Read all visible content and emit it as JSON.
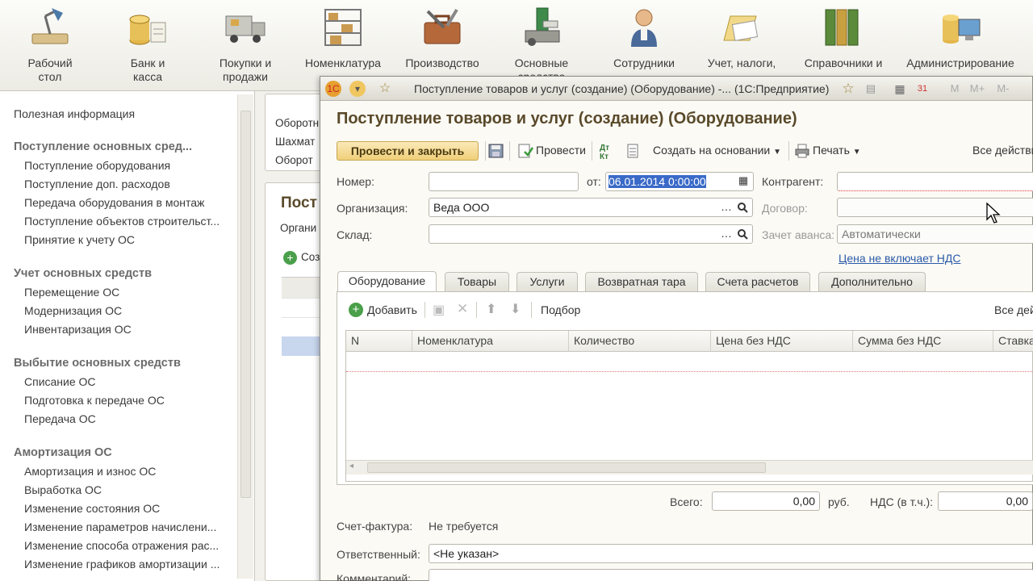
{
  "sections": [
    {
      "label": "Рабочий\nстол",
      "icon": "desk-lamp-icon"
    },
    {
      "label": "Банк и\nкасса",
      "icon": "coins-icon"
    },
    {
      "label": "Покупки и\nпродажи",
      "icon": "truck-icon"
    },
    {
      "label": "Номенклатура",
      "icon": "warehouse-shelf-icon"
    },
    {
      "label": "Производство",
      "icon": "toolbox-icon"
    },
    {
      "label": "Основные\nсредства",
      "icon": "machine-icon"
    },
    {
      "label": "Сотрудники",
      "icon": "worker-icon"
    },
    {
      "label": "Учет, налоги,",
      "icon": "folder-papers-icon"
    },
    {
      "label": "Справочники и",
      "icon": "binders-icon"
    },
    {
      "label": "Администрирование",
      "icon": "computer-icon"
    }
  ],
  "nav": {
    "top_link": "Полезная информация",
    "groups": [
      {
        "title": "Поступление основных сред...",
        "items": [
          "Поступление оборудования",
          "Поступление доп. расходов",
          "Передача оборудования в монтаж",
          "Поступление объектов строительст...",
          "Принятие к учету ОС"
        ]
      },
      {
        "title": "Учет основных средств",
        "items": [
          "Перемещение ОС",
          "Модернизация ОС",
          "Инвентаризация ОС"
        ]
      },
      {
        "title": "Выбытие основных средств",
        "items": [
          "Списание ОС",
          "Подготовка к передаче ОС",
          "Передача ОС"
        ]
      },
      {
        "title": "Амортизация ОС",
        "items": [
          "Амортизация и износ ОС",
          "Выработка ОС",
          "Изменение состояния ОС",
          "Изменение параметров начислени...",
          "Изменение способа отражения рас...",
          "Изменение графиков амортизации ..."
        ]
      }
    ]
  },
  "background": {
    "panel_lines": [
      "Оборотн",
      "Шахмат",
      "Оборот"
    ],
    "title": "Пост",
    "org_label": "Органи",
    "create_label": "Соз"
  },
  "dialog": {
    "window_title": "Поступление товаров и услуг (создание) (Оборудование) -... (1С:Предприятие)",
    "title_toolbar": [
      "М",
      "М+",
      "М-"
    ],
    "doc_title": "Поступление товаров и услуг (создание) (Оборудование)",
    "toolbar": {
      "post_close": "Провести и закрыть",
      "post": "Провести",
      "create_based": "Создать на основании",
      "print": "Печать",
      "all_actions": "Все действия"
    },
    "fields": {
      "number_label": "Номер:",
      "number_value": "",
      "date_label": "от:",
      "date_value": "06.01.2014  0:00:00",
      "counterparty_label": "Контрагент:",
      "counterparty_value": "",
      "org_label": "Организация:",
      "org_value": "Веда ООО",
      "contract_label": "Договор:",
      "contract_value": "",
      "warehouse_label": "Склад:",
      "warehouse_value": "",
      "advance_label": "Зачет аванса:",
      "advance_value": "Автоматически",
      "vat_link": "Цена не включает НДС"
    },
    "tabs": [
      "Оборудование",
      "Товары",
      "Услуги",
      "Возвратная тара",
      "Счета расчетов",
      "Дополнительно"
    ],
    "table_toolbar": {
      "add": "Добавить",
      "pick": "Подбор",
      "all_actions": "Все дей"
    },
    "columns": [
      "N",
      "Номенклатура",
      "Количество",
      "Цена без НДС",
      "Сумма без НДС",
      "Ставка"
    ],
    "totals": {
      "total_label": "Всего:",
      "total_value": "0,00",
      "currency": "руб.",
      "vat_label": "НДС (в т.ч.):",
      "vat_value": "0,00"
    },
    "invoice": {
      "label": "Счет-фактура:",
      "value": "Не требуется"
    },
    "responsible": {
      "label": "Ответственный:",
      "value": "<Не указан>"
    },
    "comment": {
      "label": "Комментарий:"
    }
  }
}
